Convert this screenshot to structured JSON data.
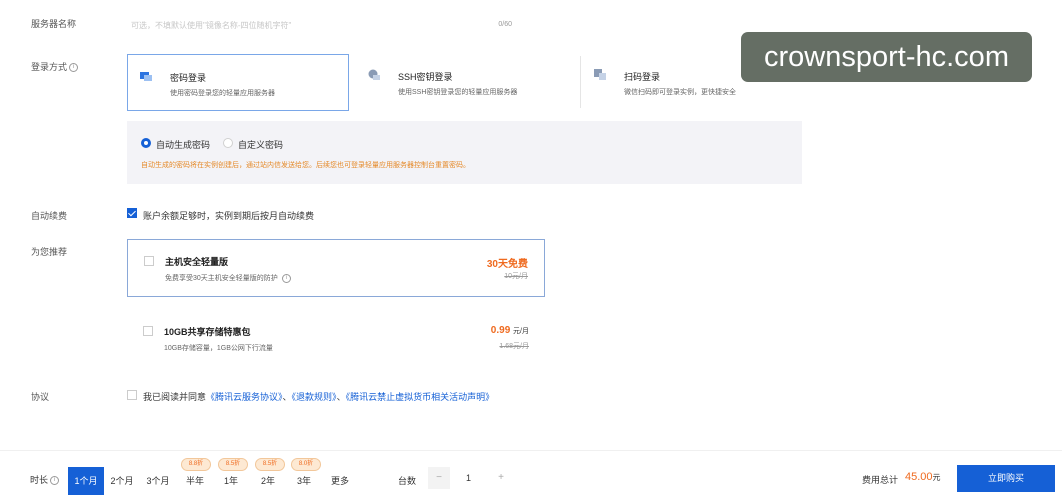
{
  "server_name": {
    "label": "服务器名称",
    "placeholder": "可选，不填默认使用\"镜像名称-四位随机字符\"",
    "counter": "0/60"
  },
  "login_method": {
    "label": "登录方式",
    "options": [
      {
        "title": "密码登录",
        "desc": "使用密码登录您的轻量应用服务器",
        "selected": true
      },
      {
        "title": "SSH密钥登录",
        "desc": "使用SSH密钥登录您的轻量应用服务器",
        "selected": false
      },
      {
        "title": "扫码登录",
        "desc": "微信扫码即可登录实例，更快捷安全",
        "selected": false
      }
    ]
  },
  "password": {
    "auto_label": "自动生成密码",
    "custom_label": "自定义密码",
    "hint": "自动生成的密码将在实例创建后，通过站内信发送给您。后续您也可登录轻量应用服务器控制台重置密码。",
    "auto_selected": true
  },
  "auto_renew": {
    "label": "自动续费",
    "text": "账户余额足够时，实例到期后按月自动续费",
    "checked": true
  },
  "recommend": {
    "label": "为您推荐",
    "items": [
      {
        "title": "主机安全轻量版",
        "desc": "免费享受30天主机安全轻量版的防护",
        "price": "30天免费",
        "unit": "",
        "old": "10元/月",
        "boxed": true
      },
      {
        "title": "10GB共享存储特惠包",
        "desc": "10GB存储容量，1GB公网下行流量",
        "price": "0.99",
        "unit": "元/月",
        "old": "1.68元/月",
        "boxed": false
      }
    ]
  },
  "agreement": {
    "label": "协议",
    "prefix": "我已阅读并同意",
    "link1": "《腾讯云服务协议》",
    "sep1": "、",
    "link2": "《退款规则》",
    "sep2": "、",
    "link3": "《腾讯云禁止虚拟货币相关活动声明》"
  },
  "bottom": {
    "duration_label": "时长",
    "durations": [
      "1个月",
      "2个月",
      "3个月",
      "半年",
      "1年",
      "2年",
      "3年",
      "更多"
    ],
    "discount_badges": [
      "8.8折",
      "8.5折",
      "8.5折",
      "8.0折"
    ],
    "qty_label": "台数",
    "qty_minus": "−",
    "qty_value": "1",
    "qty_plus": "+",
    "total_label": "费用总计",
    "total_value": "45.00",
    "total_unit": "元",
    "buy_label": "立即购买"
  },
  "watermark": "crownsport-hc.com",
  "colors": {
    "accent": "#1560d6",
    "price": "#ef6a1f",
    "hint": "#e58a2a"
  }
}
